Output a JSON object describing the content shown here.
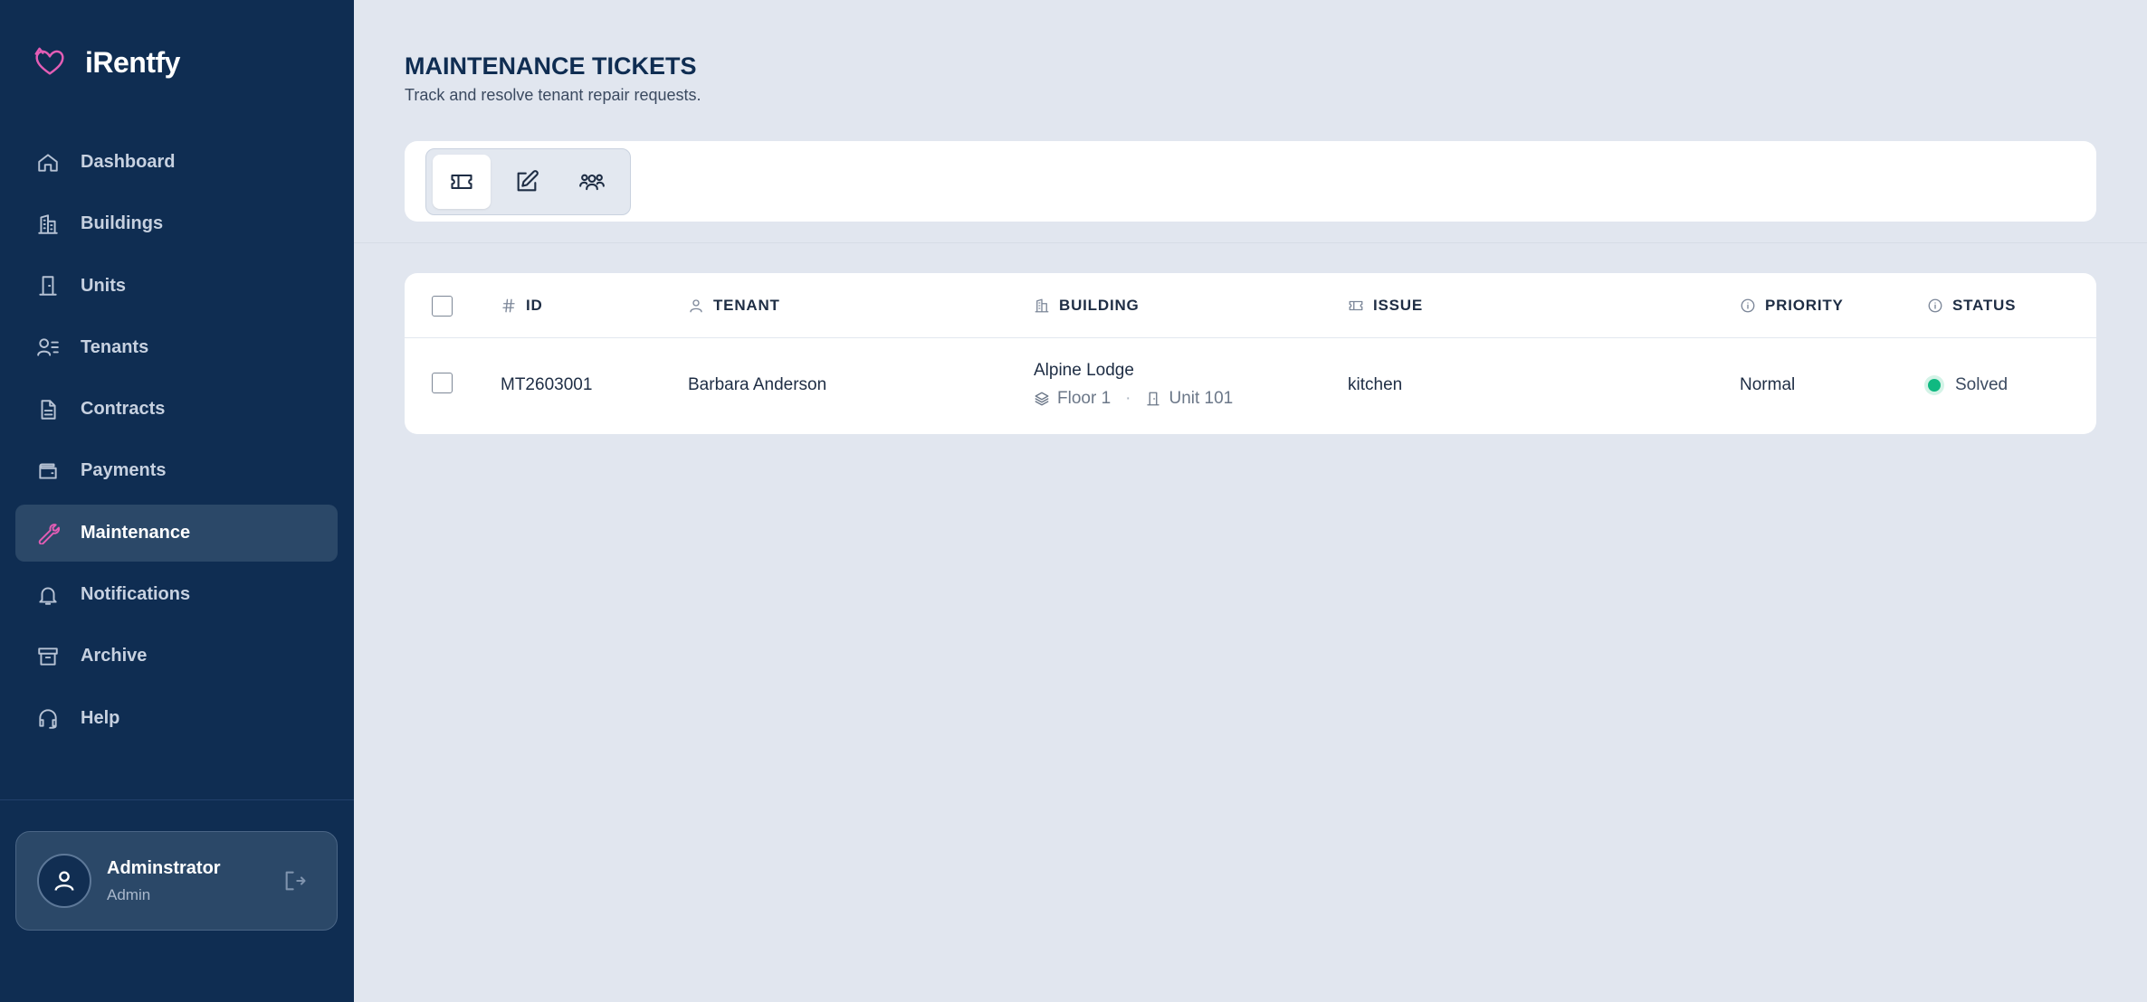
{
  "app": {
    "name": "iRentfy"
  },
  "sidebar": {
    "items": [
      {
        "label": "Dashboard",
        "icon": "home-icon"
      },
      {
        "label": "Buildings",
        "icon": "buildings-icon"
      },
      {
        "label": "Units",
        "icon": "door-icon"
      },
      {
        "label": "Tenants",
        "icon": "tenants-icon"
      },
      {
        "label": "Contracts",
        "icon": "document-icon"
      },
      {
        "label": "Payments",
        "icon": "wallet-icon"
      },
      {
        "label": "Maintenance",
        "icon": "wrench-icon",
        "active": true
      },
      {
        "label": "Notifications",
        "icon": "bell-icon"
      },
      {
        "label": "Archive",
        "icon": "archive-icon"
      },
      {
        "label": "Help",
        "icon": "headset-icon"
      }
    ],
    "user": {
      "name": "Adminstrator",
      "role": "Admin"
    }
  },
  "page": {
    "title": "MAINTENANCE TICKETS",
    "subtitle": "Track and resolve tenant repair requests."
  },
  "toolbar": {
    "views": [
      {
        "icon": "ticket-icon",
        "active": true
      },
      {
        "icon": "edit-icon",
        "active": false
      },
      {
        "icon": "users-icon",
        "active": false
      }
    ]
  },
  "table": {
    "columns": {
      "id": "ID",
      "tenant": "TENANT",
      "building": "BUILDING",
      "issue": "ISSUE",
      "priority": "PRIORITY",
      "status": "STATUS"
    },
    "rows": [
      {
        "id": "MT2603001",
        "tenant": "Barbara Anderson",
        "building": "Alpine Lodge",
        "floor": "Floor 1",
        "unit": "Unit 101",
        "issue": "kitchen",
        "priority": "Normal",
        "status": "Solved",
        "status_color": "#10b981"
      }
    ]
  },
  "colors": {
    "sidebar_bg": "#0f2d52",
    "active_item_bg": "#2b4868",
    "accent": "#e35db5",
    "page_bg": "#e1e6ef"
  }
}
